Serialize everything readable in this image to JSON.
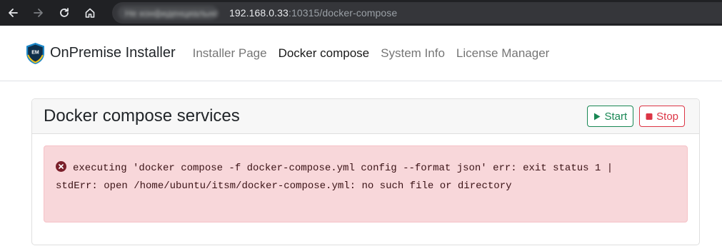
{
  "browser": {
    "security_label": "Не конфиденциально",
    "url_host": "192.168.0.33",
    "url_rest": ":10315/docker-compose"
  },
  "navbar": {
    "brand_logo_text": "EM",
    "brand": "OnPremise Installer",
    "links": [
      {
        "label": "Installer Page",
        "active": false
      },
      {
        "label": "Docker compose",
        "active": true
      },
      {
        "label": "System Info",
        "active": false
      },
      {
        "label": "License Manager",
        "active": false
      }
    ]
  },
  "card": {
    "title": "Docker compose services",
    "start_label": "Start",
    "stop_label": "Stop"
  },
  "alert": {
    "line1": "executing 'docker compose -f docker-compose.yml config --format json' err: exit status 1 |",
    "line2": "stdErr: open /home/ubuntu/itsm/docker-compose.yml: no such file or directory"
  },
  "colors": {
    "success": "#198754",
    "danger": "#dc3545",
    "alert_bg": "#f8d7da",
    "error_icon": "#7a1f2a"
  },
  "icons": {
    "back": "arrow-left-icon",
    "forward": "arrow-right-icon",
    "reload": "reload-icon",
    "home": "home-icon",
    "start": "play-icon",
    "stop": "stop-square-icon",
    "error": "x-circle-icon"
  }
}
